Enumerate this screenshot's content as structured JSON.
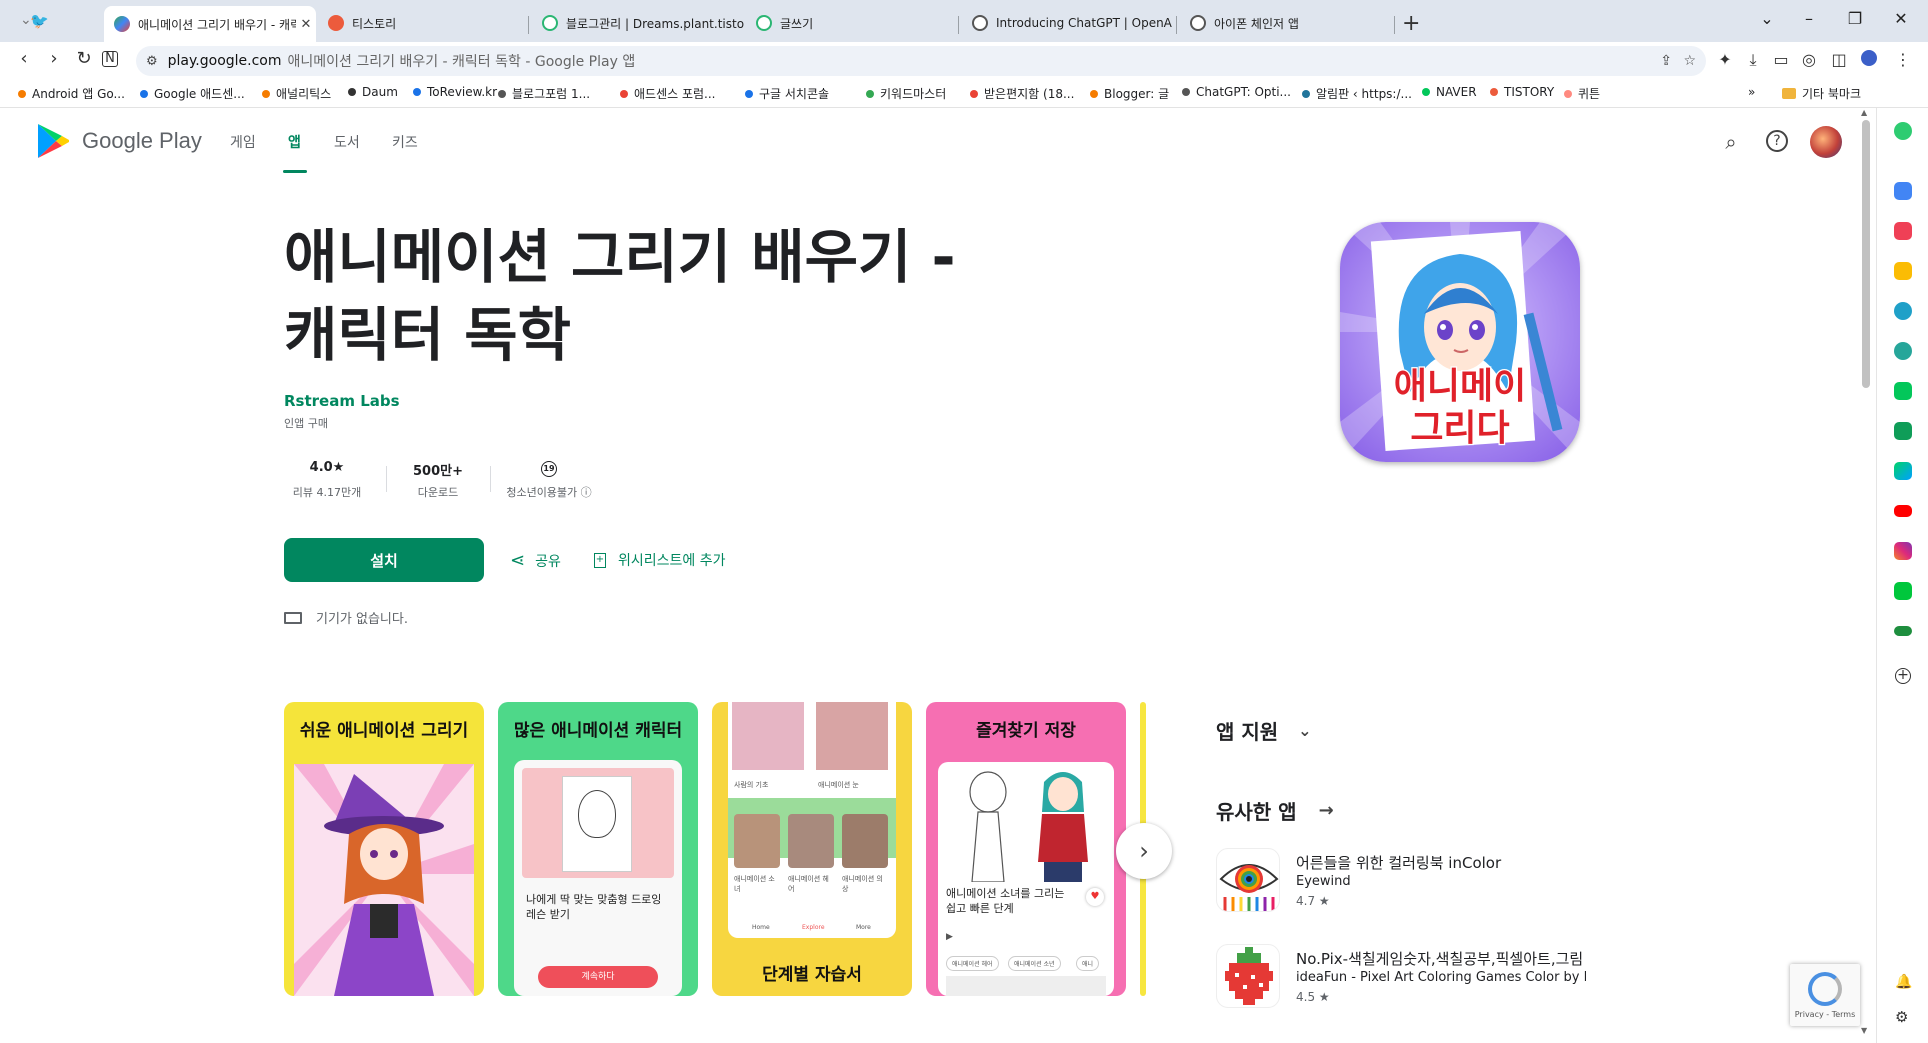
{
  "browser": {
    "tabs": [
      {
        "title": "애니메이션 그리기 배우기 - 캐릭",
        "color": "#34a853"
      },
      {
        "title": "티스토리",
        "color": "#ec5b3c"
      },
      {
        "title": "블로그관리 | Dreams.plant.tistory",
        "color": "#2bb673"
      },
      {
        "title": "글쓰기",
        "color": "#2bb673"
      },
      {
        "title": "Introducing ChatGPT | OpenAI",
        "color": "#555555"
      },
      {
        "title": "아이폰 체인저 앱",
        "color": "#555555"
      }
    ],
    "url_host": "play.google.com",
    "url_path": "애니메이션 그리기 배우기 - 캐릭터 독학 - Google Play 앱",
    "bookmarks": [
      {
        "label": "Android 앱 Go...",
        "color": "#f57c00"
      },
      {
        "label": "Google 애드센...",
        "color": "#1a73e8"
      },
      {
        "label": "애널리틱스",
        "color": "#f57c00"
      },
      {
        "label": "Daum",
        "color": "#333333"
      },
      {
        "label": "ToReview.kr",
        "color": "#1a73e8"
      },
      {
        "label": "블로그포럼 1...",
        "color": "#555555"
      },
      {
        "label": "애드센스 포럼...",
        "color": "#ea4335"
      },
      {
        "label": "구글 서치콘솔",
        "color": "#1a73e8"
      },
      {
        "label": "키워드마스터",
        "color": "#34a853"
      },
      {
        "label": "받은편지함 (18...",
        "color": "#ea4335"
      },
      {
        "label": "Blogger: 글",
        "color": "#f57c00"
      },
      {
        "label": "ChatGPT: Opti...",
        "color": "#555555"
      },
      {
        "label": "알림판 ‹ https:/...",
        "color": "#21759b"
      },
      {
        "label": "NAVER",
        "color": "#03c75a"
      },
      {
        "label": "TISTORY",
        "color": "#ec5b3c"
      },
      {
        "label": "퀴튼",
        "color": "#ff8a80"
      }
    ],
    "bookmarks_more": "»",
    "other_bookmarks": "기타 북마크"
  },
  "gp": {
    "logo": "Google Play",
    "nav": [
      "게임",
      "앱",
      "도서",
      "키즈"
    ],
    "active_nav": "앱"
  },
  "app": {
    "title_line1": "애니메이션 그리기 배우기 -",
    "title_line2": "캐릭터 독학",
    "developer": "Rstream Labs",
    "iap": "인앱 구매",
    "rating": "4.0★",
    "reviews": "리뷰 4.17만개",
    "downloads": "500만+",
    "downloads_label": "다운로드",
    "age_badge": "19",
    "age_label": "청소년이용불가 ⓘ",
    "install": "설치",
    "share": "공유",
    "wishlist": "위시리스트에 추가",
    "no_device": "기기가 없습니다.",
    "icon_text_1": "애니메이",
    "icon_text_2": "그리다"
  },
  "screenshots": [
    {
      "caption": "쉬운 애니메이션 그리기",
      "bg": "#f5e43a"
    },
    {
      "caption": "많은 애니메이션 캐릭터",
      "bg": "#4ed889"
    },
    {
      "caption": "단계별 자습서",
      "bg": "#f7d640"
    },
    {
      "caption": "즐겨찾기 저장",
      "bg": "#f66fb2"
    }
  ],
  "shot2_text": "나에게 딱 맞는 맞춤형 드로잉 레슨 받기",
  "shot2_button": "계속하다",
  "shot3_labels": [
    "사람의 기초",
    "애니메이션 눈",
    "애니메이션 소녀",
    "애니메이션 헤어",
    "애니메이션 의상"
  ],
  "shot3_nav": [
    "Home",
    "Explore",
    "More"
  ],
  "shot4_text": "애니메이션 소녀를 그리는 쉽고 빠른 단계",
  "shot4_chips": [
    "애니메이션 헤어",
    "애니메이션 소년",
    "애니"
  ],
  "sidebar": {
    "app_support": "앱 지원",
    "similar_apps": "유사한 앱",
    "apps": [
      {
        "name": "어른들을 위한 컬러링북 inColor",
        "developer": "Eyewind",
        "rating": "4.7 ★"
      },
      {
        "name": "No.Pix-색칠게임숫자,색칠공부,픽셀아트,그림",
        "developer": "ideaFun - Pixel Art Coloring Games Color by N",
        "rating": "4.5 ★"
      }
    ]
  },
  "recaptcha_text": "Privacy - Terms",
  "colors": {
    "accent": "#01875f"
  }
}
